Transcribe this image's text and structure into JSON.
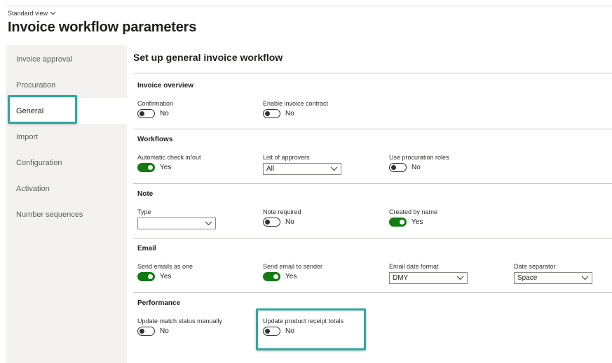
{
  "header": {
    "view_selector": "Standard view",
    "title": "Invoice workflow parameters"
  },
  "sidebar": {
    "items": [
      {
        "label": "Invoice approval"
      },
      {
        "label": "Procuration"
      },
      {
        "label": "General"
      },
      {
        "label": "Import"
      },
      {
        "label": "Configuration"
      },
      {
        "label": "Activation"
      },
      {
        "label": "Number sequences"
      }
    ],
    "active": "General"
  },
  "main": {
    "heading": "Set up general invoice workflow",
    "sections": {
      "invoice_overview": {
        "title": "Invoice overview",
        "confirmation": {
          "label": "Confirmation",
          "value": "No"
        },
        "enable_invoice_contract": {
          "label": "Enable invoice contract",
          "value": "No"
        }
      },
      "workflows": {
        "title": "Workflows",
        "automatic_check": {
          "label": "Automatic check in/out",
          "value": "Yes"
        },
        "list_of_approvers": {
          "label": "List of approvers",
          "value": "All"
        },
        "use_procuration_roles": {
          "label": "Use procuration roles",
          "value": "No"
        }
      },
      "note": {
        "title": "Note",
        "type": {
          "label": "Type",
          "value": ""
        },
        "note_required": {
          "label": "Note required",
          "value": "No"
        },
        "created_by_name": {
          "label": "Created by name",
          "value": "Yes"
        }
      },
      "email": {
        "title": "Email",
        "send_emails_as_one": {
          "label": "Send emails as one",
          "value": "Yes"
        },
        "send_email_to_sender": {
          "label": "Send email to sender",
          "value": "Yes"
        },
        "email_date_format": {
          "label": "Email date format",
          "value": "DMY"
        },
        "date_separator": {
          "label": "Date separator",
          "value": "Space"
        }
      },
      "performance": {
        "title": "Performance",
        "update_match_status": {
          "label": "Update match status manually",
          "value": "No"
        },
        "update_product_receipt": {
          "label": "Update product receipt totals",
          "value": "No"
        }
      }
    }
  },
  "colors": {
    "toggle_on": "#107c10",
    "highlight": "#2ea89e",
    "sidebar_bg": "#f3f2f1"
  },
  "icons": {
    "view_chevron": "chevron-down-icon",
    "dropdown_chevron": "chevron-down-icon"
  }
}
